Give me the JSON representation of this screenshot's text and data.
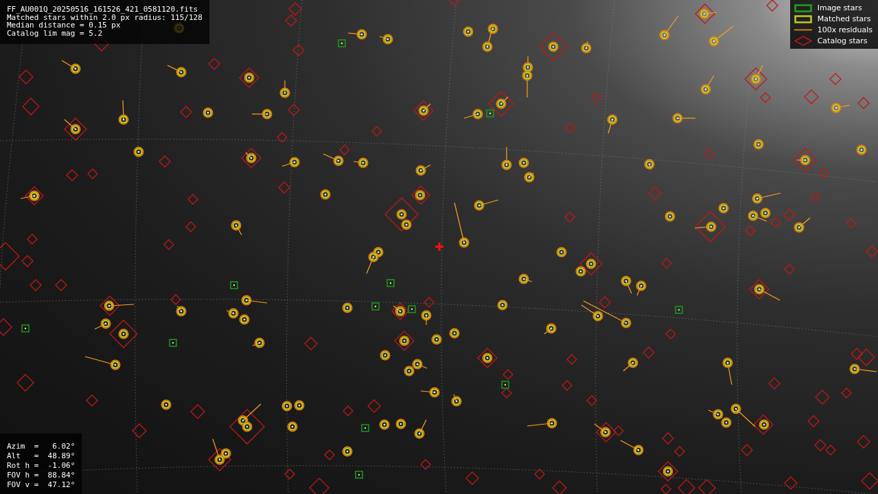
{
  "info_panel": {
    "lines": [
      "FF_AU001Q_20250516_161526_421_0581120.fits",
      "Matched stars within 2.0 px radius: 115/128",
      "Median distance = 0.15 px",
      "Catalog lim mag = 5.2"
    ]
  },
  "legend": {
    "items": [
      {
        "kind": "image",
        "label": "Image stars"
      },
      {
        "kind": "matched",
        "label": "Matched stars"
      },
      {
        "kind": "residual",
        "label": "100x residuals"
      },
      {
        "kind": "catalog",
        "label": "Catalog stars"
      }
    ]
  },
  "pointing_panel": {
    "lines": [
      "Azim  =   6.02°",
      "Alt   =  48.89°",
      "Rot h =  -1.06°",
      "FOV h =  88.84°",
      "FOV v =  47.12°"
    ]
  }
}
